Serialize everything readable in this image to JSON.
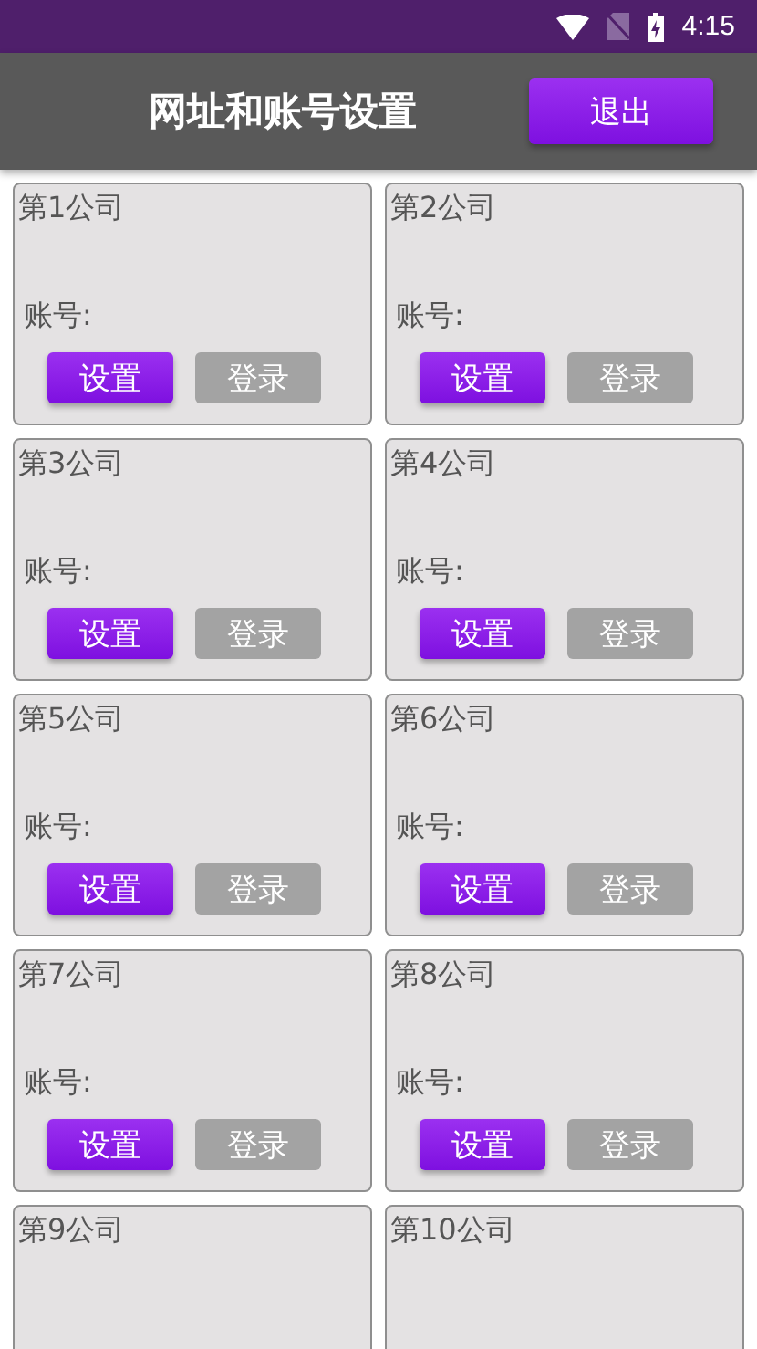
{
  "status_bar": {
    "time": "4:15"
  },
  "app_bar": {
    "title": "网址和账号设置",
    "exit_button": "退出"
  },
  "companies": [
    {
      "title": "第1公司",
      "account_label": "账号:",
      "setup_button": "设置",
      "login_button": "登录"
    },
    {
      "title": "第2公司",
      "account_label": "账号:",
      "setup_button": "设置",
      "login_button": "登录"
    },
    {
      "title": "第3公司",
      "account_label": "账号:",
      "setup_button": "设置",
      "login_button": "登录"
    },
    {
      "title": "第4公司",
      "account_label": "账号:",
      "setup_button": "设置",
      "login_button": "登录"
    },
    {
      "title": "第5公司",
      "account_label": "账号:",
      "setup_button": "设置",
      "login_button": "登录"
    },
    {
      "title": "第6公司",
      "account_label": "账号:",
      "setup_button": "设置",
      "login_button": "登录"
    },
    {
      "title": "第7公司",
      "account_label": "账号:",
      "setup_button": "设置",
      "login_button": "登录"
    },
    {
      "title": "第8公司",
      "account_label": "账号:",
      "setup_button": "设置",
      "login_button": "登录"
    },
    {
      "title": "第9公司"
    },
    {
      "title": "第10公司"
    }
  ]
}
